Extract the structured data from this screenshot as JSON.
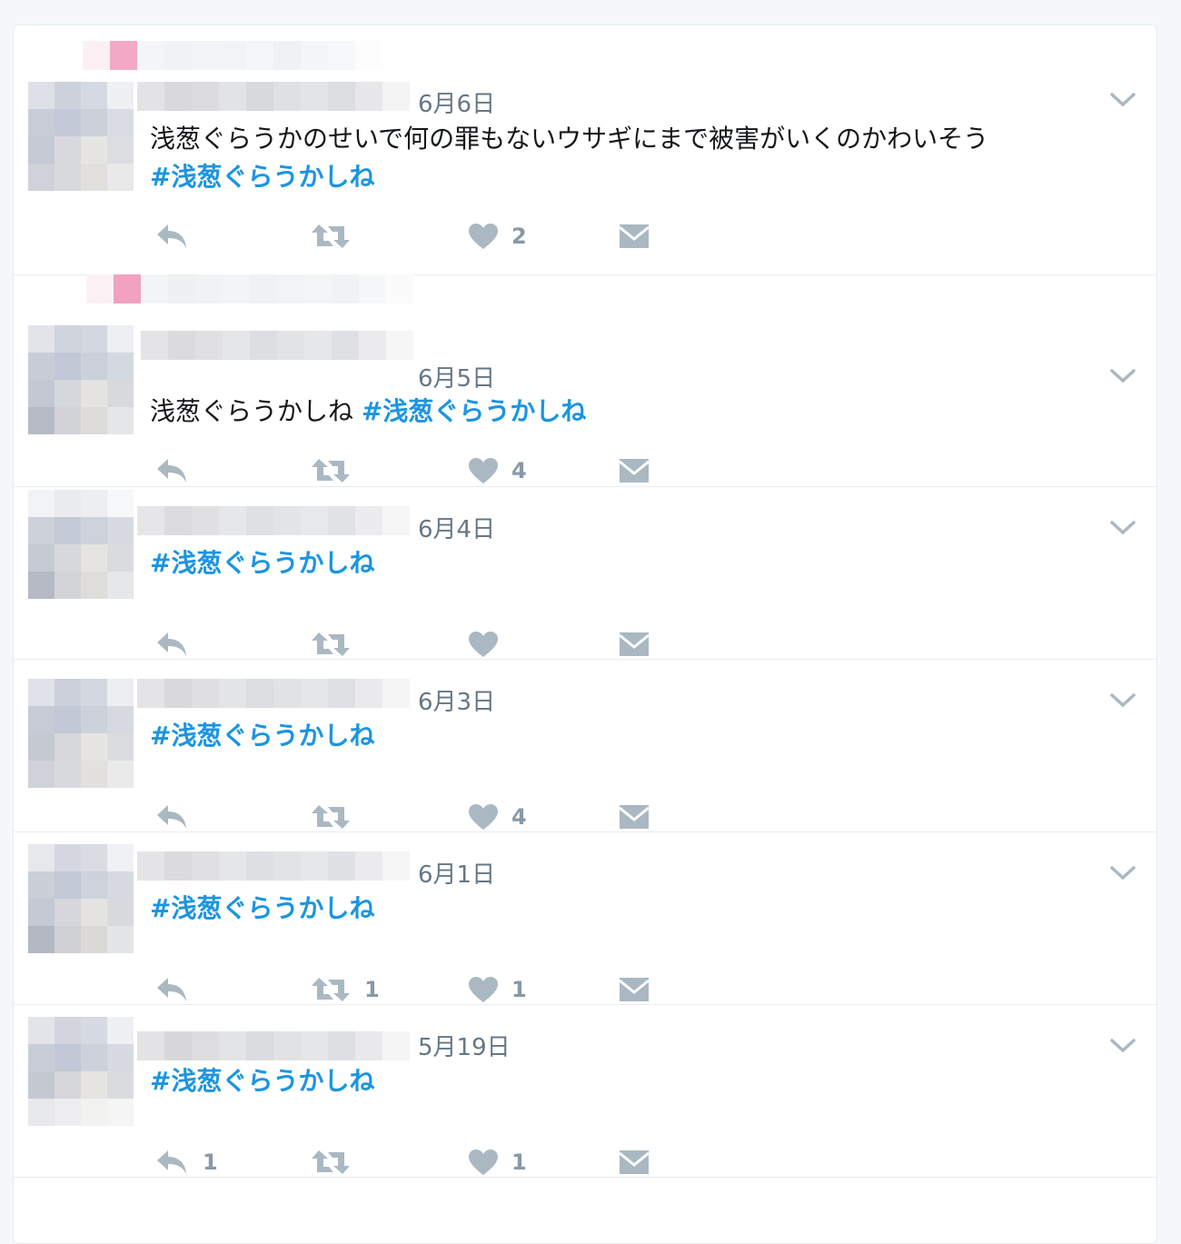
{
  "colors": {
    "background": "#f5f8fa",
    "card": "#ffffff",
    "border": "#e6ecf0",
    "hashtag": "#1b95e0",
    "muted": "#657786",
    "icon": "#aab8c2"
  },
  "tweets": [
    {
      "date": "6月6日",
      "text": "浅葱ぐらうかのせいで何の罪もないウサギにまで被害がいくのかわいそう",
      "hashtag": "#浅葱ぐらうかしね",
      "reply_count": "",
      "retweet_count": "",
      "like_count": "2"
    },
    {
      "date": "6月5日",
      "text": "浅葱ぐらうかしね",
      "hashtag": "#浅葱ぐらうかしね",
      "reply_count": "",
      "retweet_count": "",
      "like_count": "4"
    },
    {
      "date": "6月4日",
      "text": "",
      "hashtag": "#浅葱ぐらうかしね",
      "reply_count": "",
      "retweet_count": "",
      "like_count": ""
    },
    {
      "date": "6月3日",
      "text": "",
      "hashtag": "#浅葱ぐらうかしね",
      "reply_count": "",
      "retweet_count": "",
      "like_count": "4"
    },
    {
      "date": "6月1日",
      "text": "",
      "hashtag": "#浅葱ぐらうかしね",
      "reply_count": "",
      "retweet_count": "1",
      "like_count": "1"
    },
    {
      "date": "5月19日",
      "text": "",
      "hashtag": "#浅葱ぐらうかしね",
      "reply_count": "1",
      "retweet_count": "",
      "like_count": "1"
    }
  ],
  "icons": {
    "reply": "reply-icon",
    "retweet": "retweet-icon",
    "like": "heart-icon",
    "dm": "direct-message-icon",
    "menu": "chevron-down-icon"
  }
}
